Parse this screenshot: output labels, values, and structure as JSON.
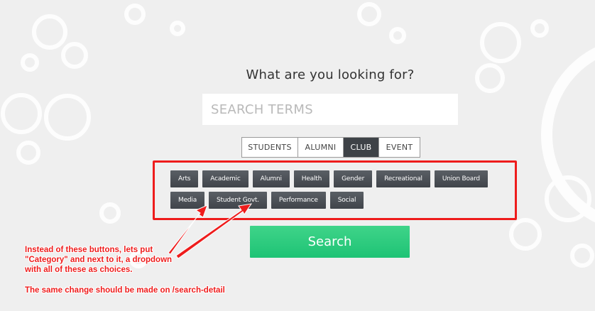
{
  "headline": "What are you looking for?",
  "search": {
    "placeholder": "SEARCH TERMS"
  },
  "type_tabs": [
    {
      "label": "STUDENTS",
      "active": false
    },
    {
      "label": "ALUMNI",
      "active": false
    },
    {
      "label": "CLUB",
      "active": true
    },
    {
      "label": "EVENT",
      "active": false
    }
  ],
  "categories": {
    "row1": [
      "Arts",
      "Academic",
      "Alumni",
      "Health",
      "Gender",
      "Recreational",
      "Union Board"
    ],
    "row2": [
      "Media",
      "Student Govt.",
      "Performance",
      "Social"
    ]
  },
  "search_button": "Search",
  "annotation": {
    "lines": [
      "Instead of these buttons, lets put",
      "\"Category\" and next to it, a dropdown",
      "with all of these as choices."
    ],
    "second": "The same change should be made on /search-detail",
    "color": "#ee1c1c"
  },
  "colors": {
    "background": "#efefef",
    "category_button": "#4a4e54",
    "active_tab": "#3e4247",
    "search_button": "#2ecb7e",
    "annotation": "#ee1c1c"
  }
}
